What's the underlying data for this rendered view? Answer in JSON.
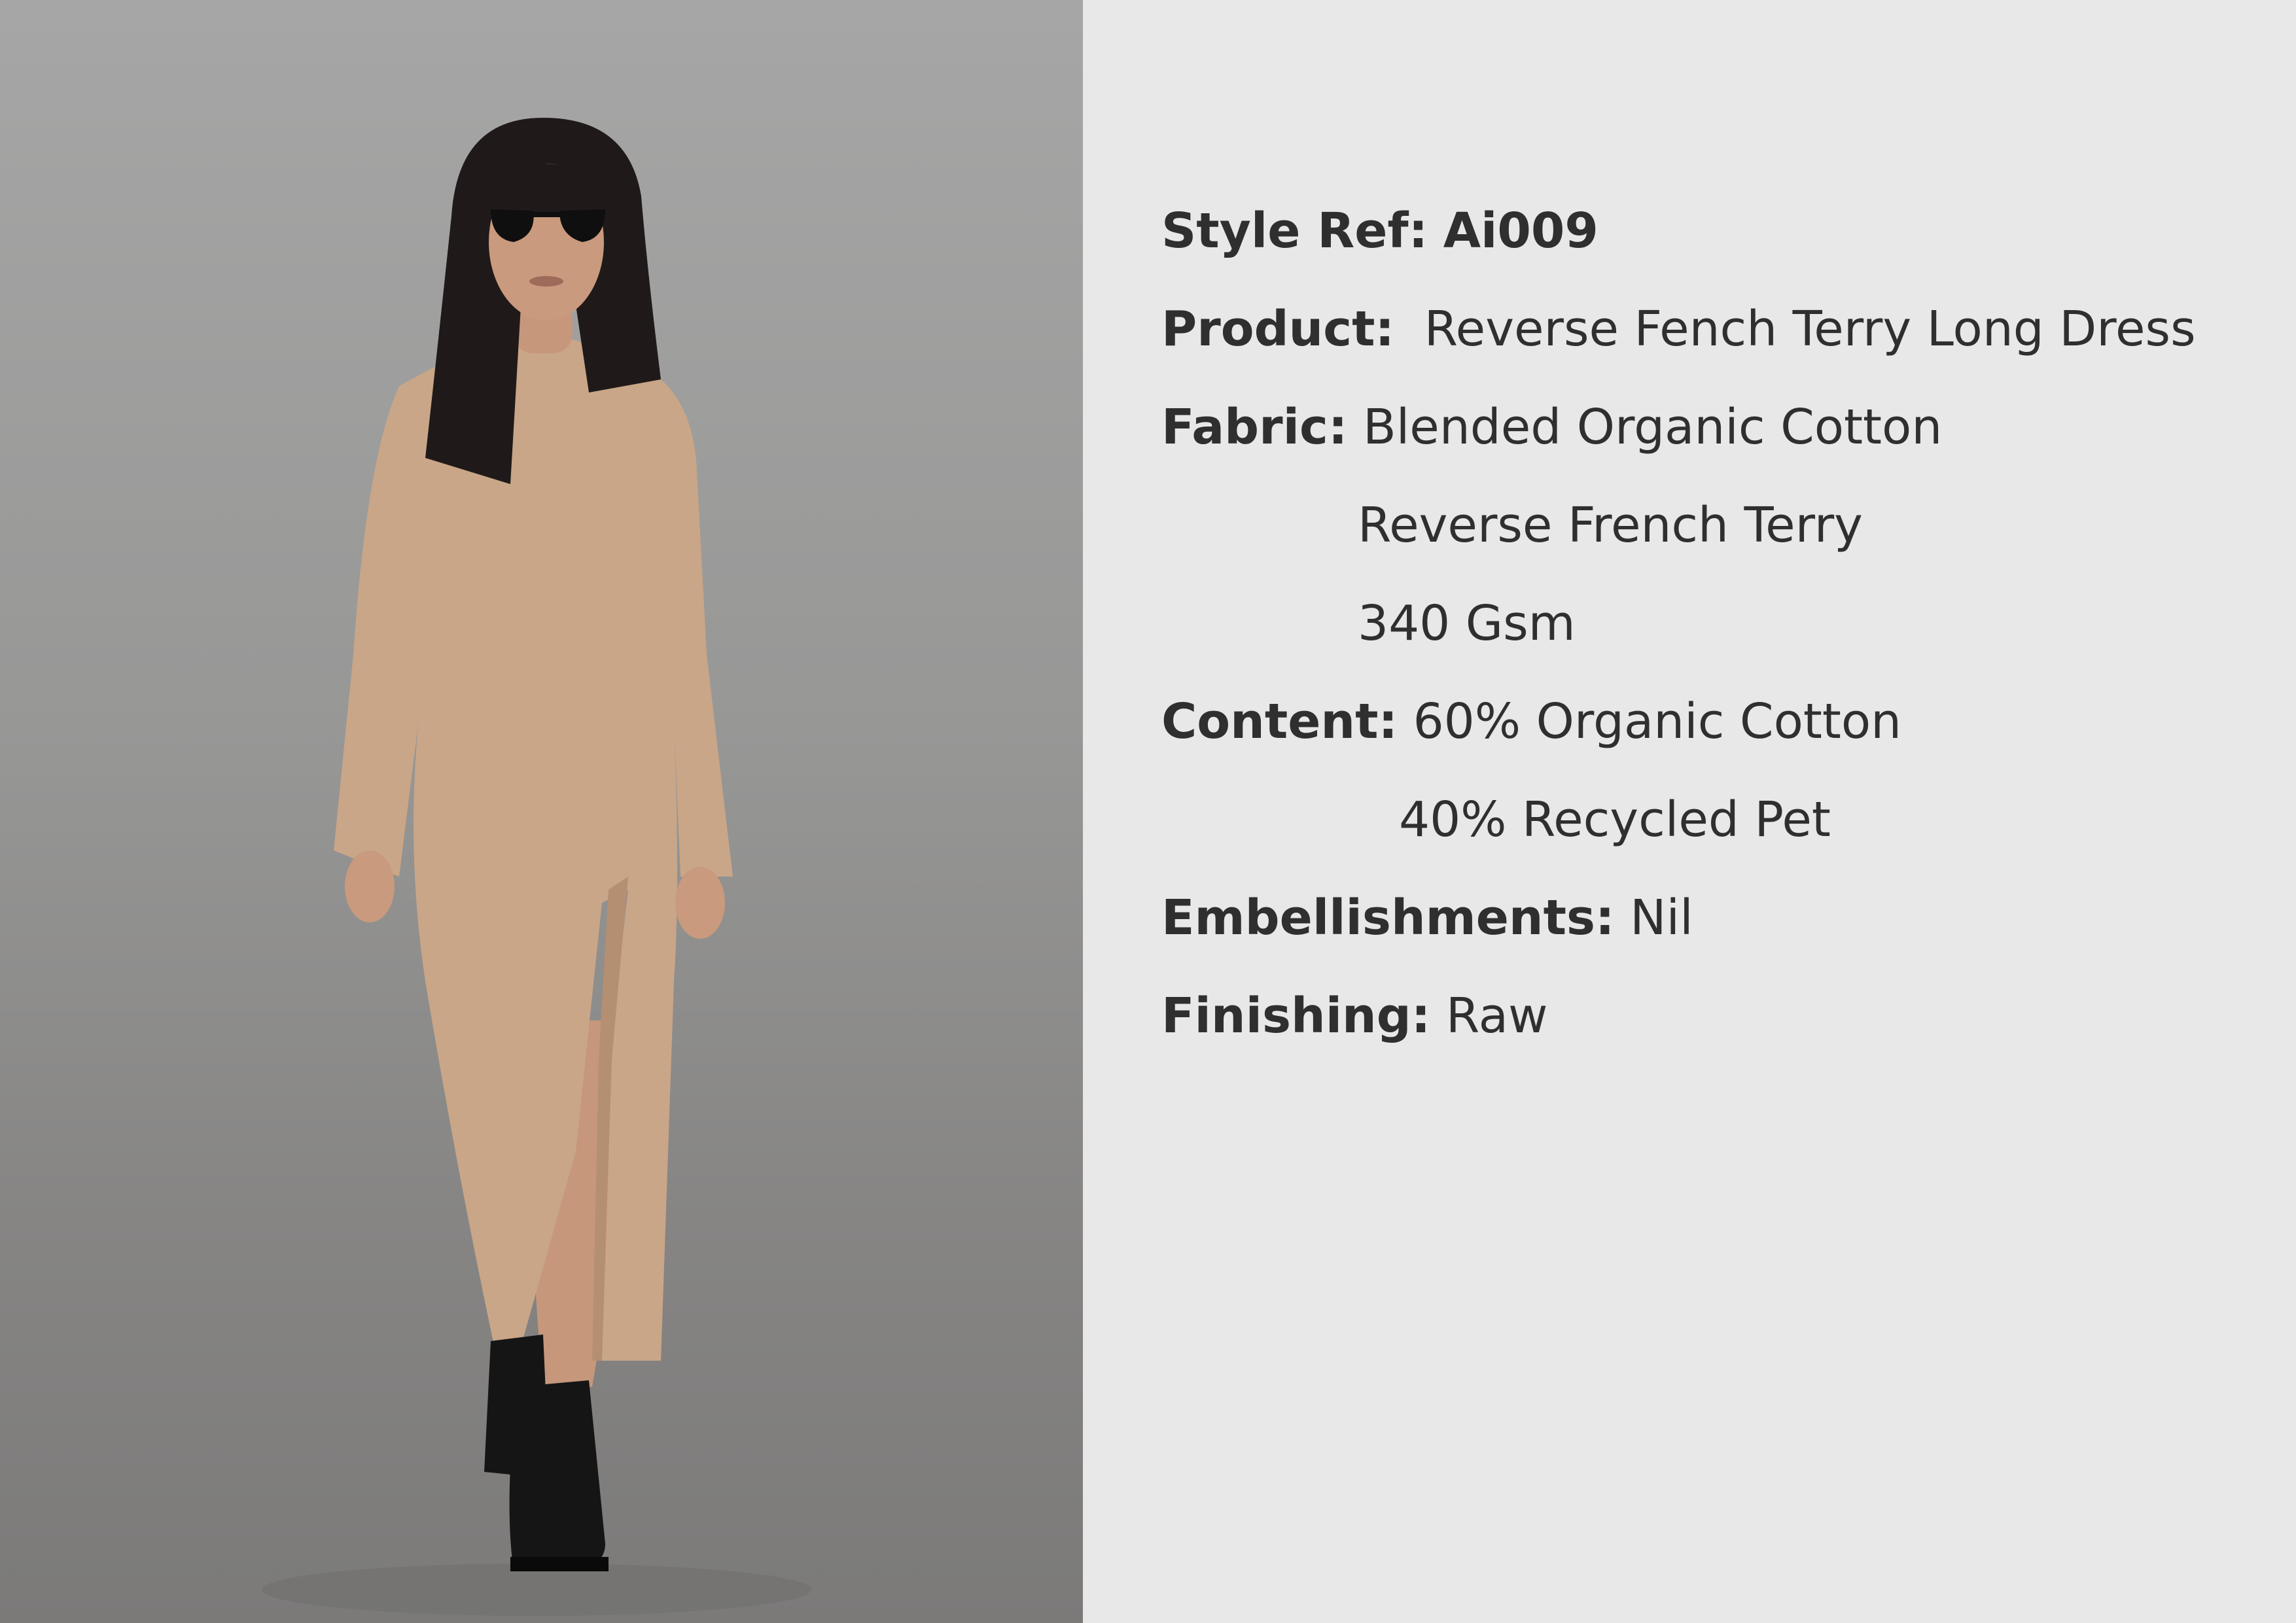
{
  "colors": {
    "page_background": "#e8e8e8",
    "text": "#2f2f2f",
    "photo_background": "#969695",
    "dress": "#c9a688",
    "hair": "#1f1a19",
    "skin": "#c99a7d",
    "boots": "#151515"
  },
  "photo": {
    "description_icon": "model-photo"
  },
  "spec": {
    "style_ref_label": "Style Ref:",
    "style_ref_value": "Ai009",
    "product_label": "Product:",
    "product_value": "Reverse Fench Terry Long Dress",
    "fabric_label": "Fabric:",
    "fabric_lines": [
      "Blended Organic Cotton",
      "Reverse  French Terry",
      "340 Gsm"
    ],
    "content_label": "Content:",
    "content_lines": [
      "60% Organic Cotton",
      "40% Recycled Pet"
    ],
    "embellishments_label": "Embellishments:",
    "embellishments_value": "Nil",
    "finishing_label": "Finishing:",
    "finishing_value": "Raw"
  }
}
